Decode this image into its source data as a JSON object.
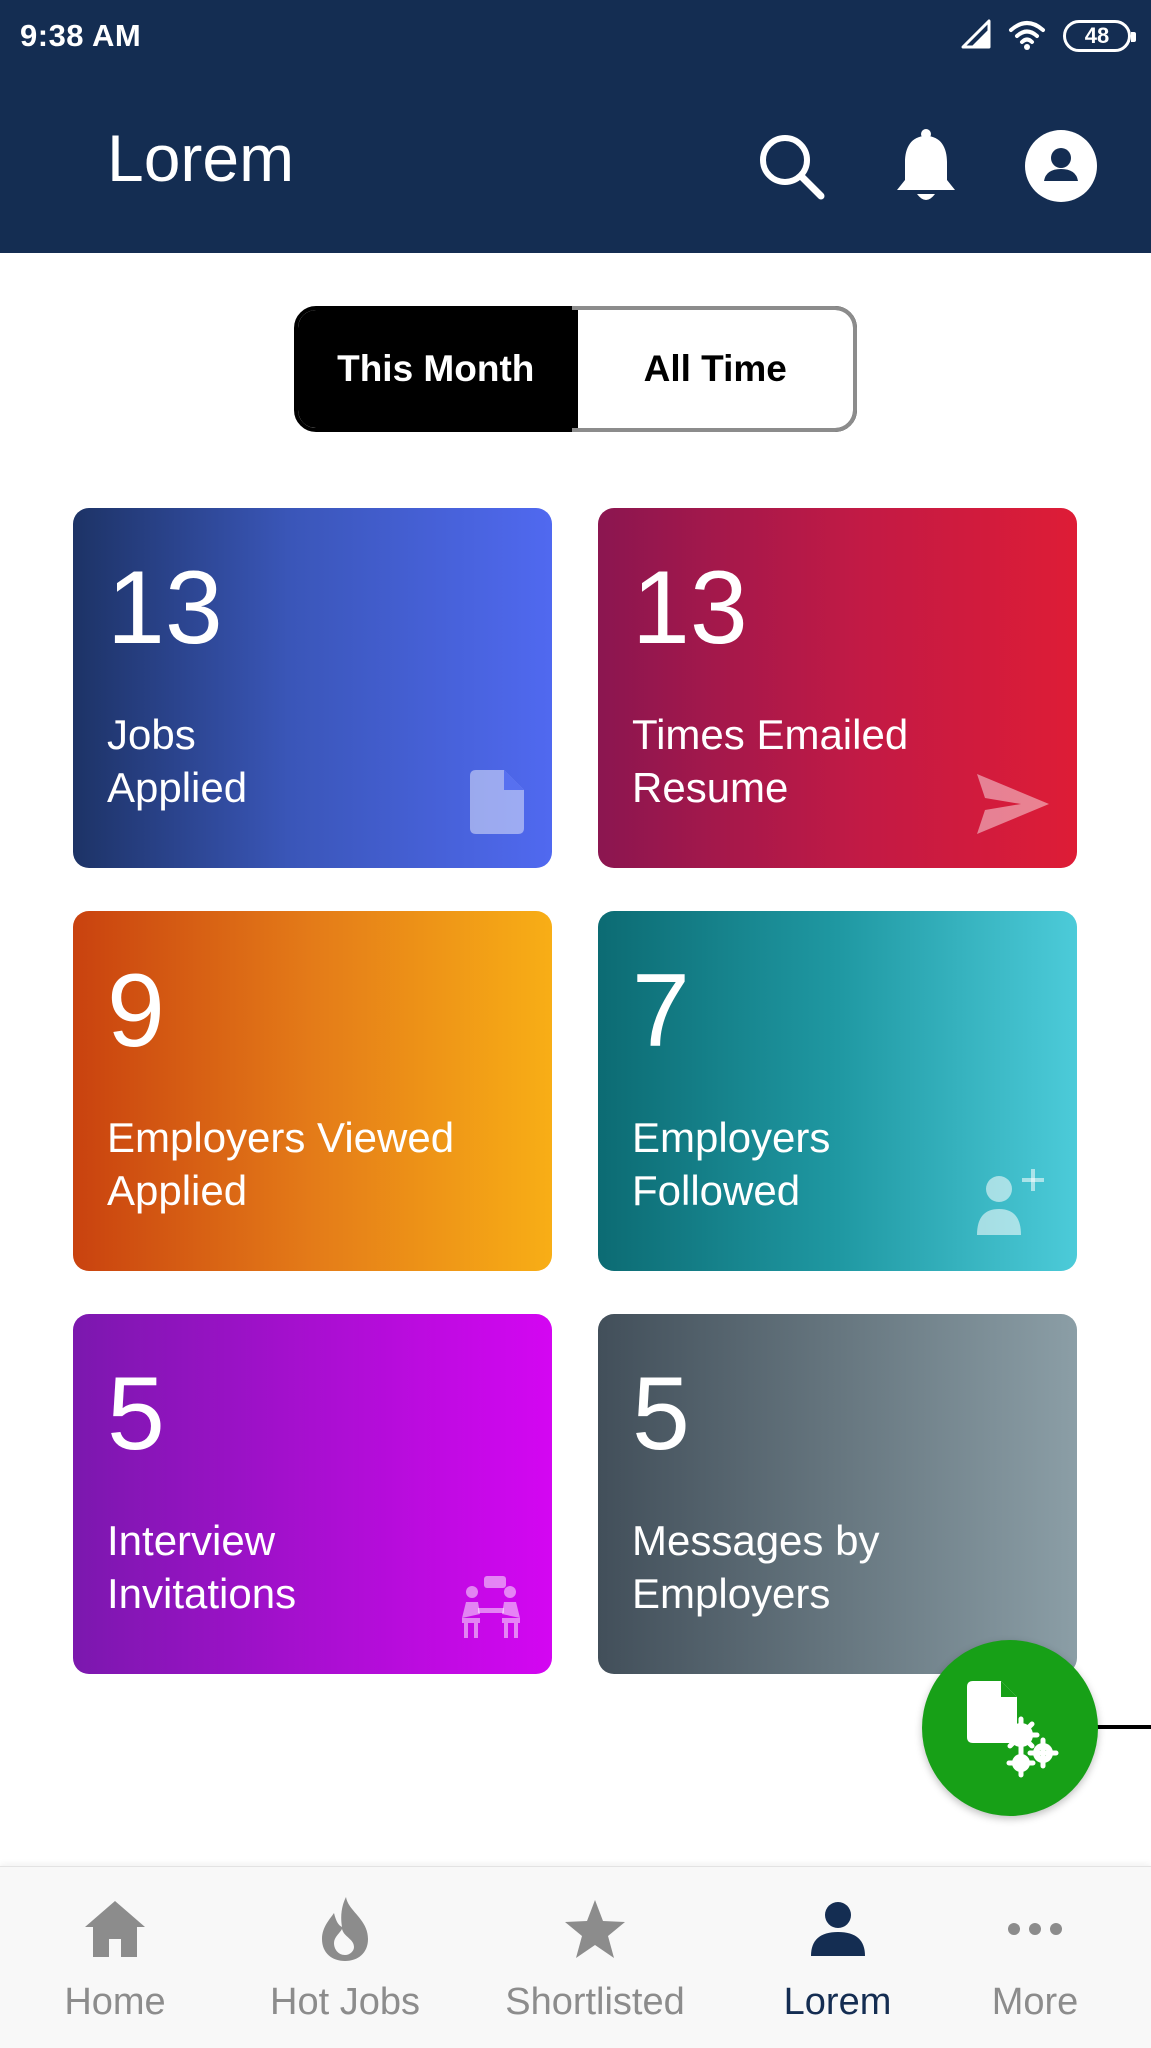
{
  "status_bar": {
    "time": "9:38 AM",
    "battery": "48"
  },
  "header": {
    "title": "Lorem",
    "actions": [
      "search-icon",
      "bell-icon",
      "account-icon"
    ]
  },
  "period_toggle": {
    "options": [
      "This Month",
      "All Time"
    ],
    "selected": "This Month"
  },
  "stats": [
    {
      "value": "13",
      "label": "Jobs Applied",
      "label_lines": [
        "Jobs",
        "Applied"
      ],
      "icon": "document-icon",
      "colors": [
        "#1d3366",
        "#5069f0"
      ]
    },
    {
      "value": "13",
      "label": "Times Emailed Resume",
      "label_lines": [
        "Times Emailed",
        "Resume"
      ],
      "icon": "send-icon",
      "colors": [
        "#8b1650",
        "#de1c36"
      ]
    },
    {
      "value": "9",
      "label": "Employers Viewed Applied",
      "label_lines": [
        "Employers Viewed",
        "Applied"
      ],
      "icon": "",
      "colors": [
        "#c9420f",
        "#f8ae16"
      ]
    },
    {
      "value": "7",
      "label": "Employers Followed",
      "label_lines": [
        "Employers",
        "Followed"
      ],
      "icon": "add-person-icon",
      "colors": [
        "#0c6b73",
        "#4ccbd9"
      ]
    },
    {
      "value": "5",
      "label": "Interview Invitations",
      "label_lines": [
        "Interview",
        "Invitations"
      ],
      "icon": "interview-icon",
      "colors": [
        "#7b18ae",
        "#d406f2"
      ]
    },
    {
      "value": "5",
      "label": "Messages by Employers",
      "label_lines": [
        "Messages by",
        "Employers"
      ],
      "icon": "",
      "colors": [
        "#424f5a",
        "#8b9ea6"
      ]
    }
  ],
  "fab": {
    "icon": "document-settings-icon",
    "color": "#17a017"
  },
  "bottom_nav": {
    "items": [
      {
        "label": "Home",
        "icon": "home-icon"
      },
      {
        "label": "Hot Jobs",
        "icon": "flame-icon"
      },
      {
        "label": "Shortlisted",
        "icon": "star-icon"
      },
      {
        "label": "Lorem",
        "icon": "person-icon"
      },
      {
        "label": "More",
        "icon": "more-dots-icon"
      }
    ],
    "active": "Lorem"
  },
  "colors": {
    "header_bg": "#142d52",
    "nav_active": "#142d52",
    "nav_inactive": "#8c8c8c",
    "fab": "#17a017"
  }
}
